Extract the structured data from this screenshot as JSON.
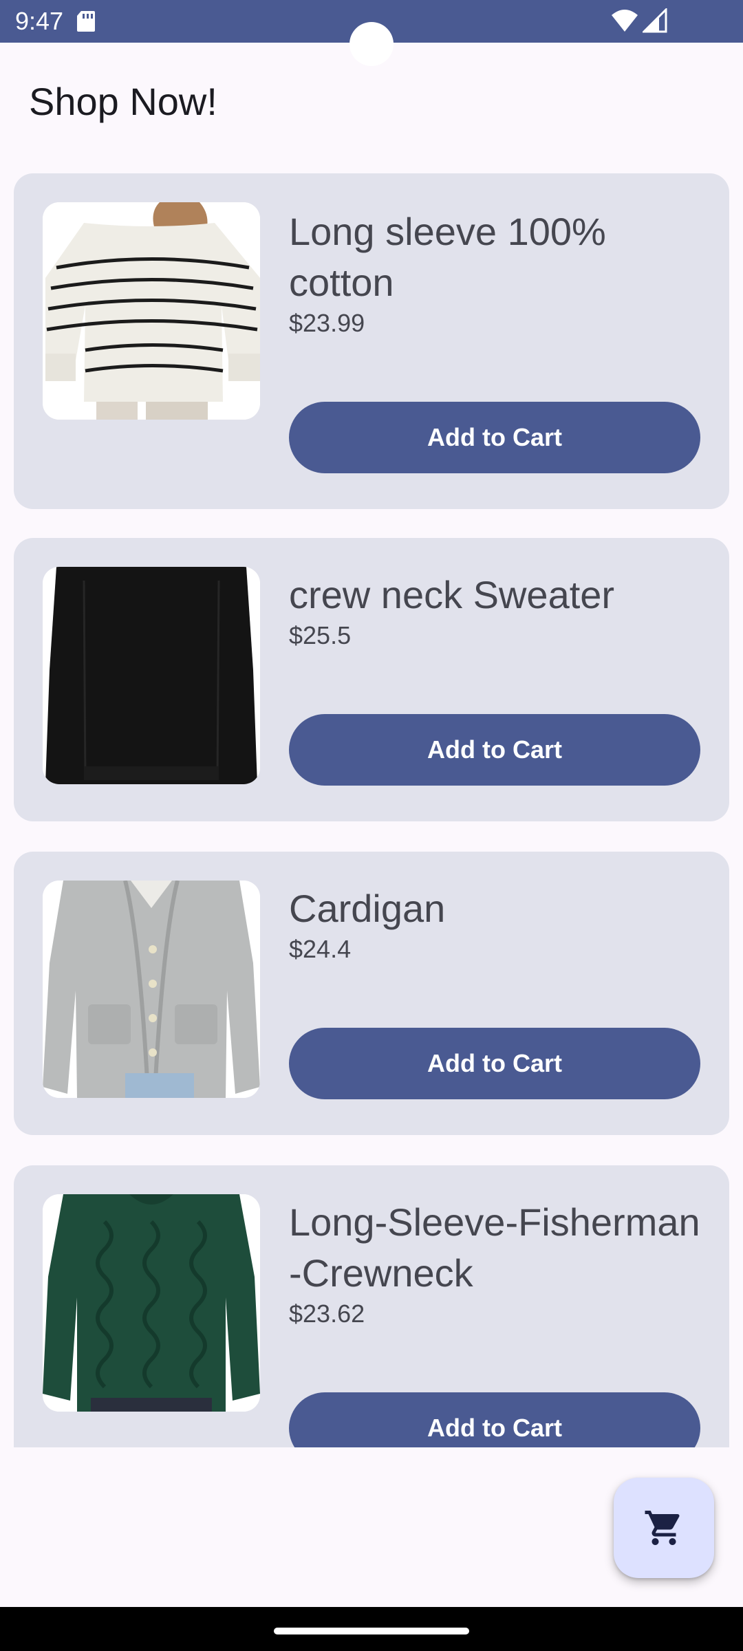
{
  "status_bar": {
    "time": "9:47",
    "icons": [
      "sd-card-icon",
      "wifi-icon",
      "signal-icon"
    ],
    "background": "#4a5a92"
  },
  "header": {
    "title": "Shop Now!"
  },
  "products": [
    {
      "name": "Long sleeve 100% cotton",
      "price": "$23.99",
      "button_label": "Add to Cart",
      "image": "striped-sweater-image"
    },
    {
      "name": "crew neck Sweater",
      "price": "$25.5",
      "button_label": "Add to Cart",
      "image": "black-sweater-image"
    },
    {
      "name": "Cardigan",
      "price": "$24.4",
      "button_label": "Add to Cart",
      "image": "grey-cardigan-image"
    },
    {
      "name": "Long-Sleeve-Fisherman -Crewneck",
      "price": "$23.62",
      "button_label": "Add to Cart",
      "image": "green-cable-knit-sweater-image"
    }
  ],
  "fab": {
    "icon": "shopping-cart-icon"
  },
  "colors": {
    "primary": "#4a5a92",
    "card_background": "#e1e2ec",
    "page_background": "#fcf8fd",
    "fab_background": "#dde1ff",
    "text": "#45464f"
  }
}
